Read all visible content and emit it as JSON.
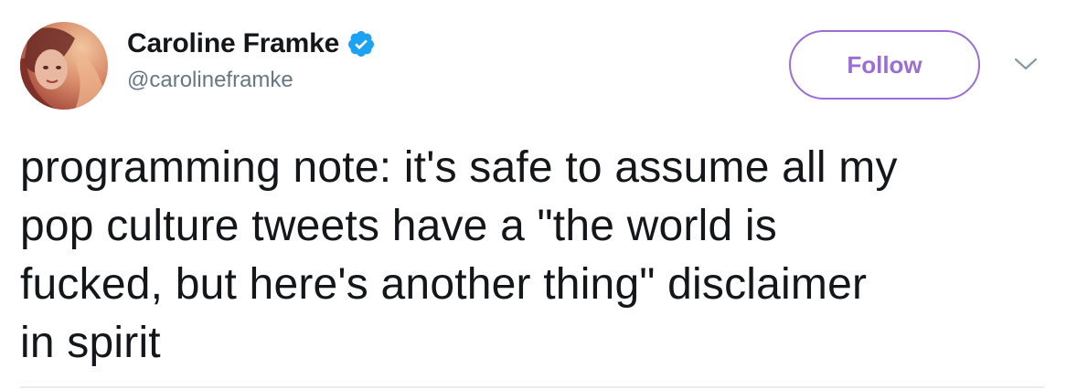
{
  "author": {
    "display_name": "Caroline Framke",
    "handle": "@carolineframke",
    "verified_icon": "verified-badge-icon",
    "avatar_icon": "profile-photo"
  },
  "actions": {
    "follow_label": "Follow",
    "more_icon": "chevron-down-icon"
  },
  "tweet": {
    "lines": [
      "programming note: it's safe to assume all my",
      "pop culture tweets have a \"the world is",
      "fucked, but here's another thing\" disclaimer",
      "in spirit"
    ]
  },
  "colors": {
    "follow_accent": "#9a6dd7",
    "verified_blue": "#1da1f2",
    "handle_gray": "#657786",
    "text": "#14171a"
  }
}
